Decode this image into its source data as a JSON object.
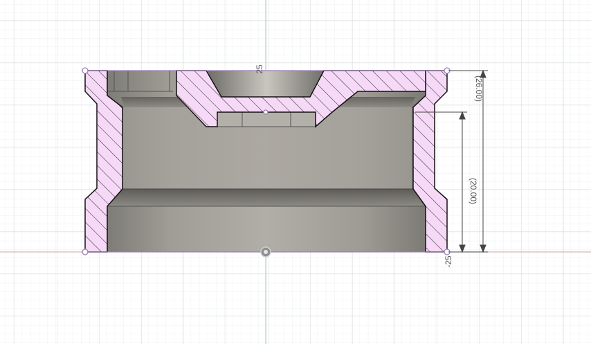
{
  "viewport": {
    "background_color": "#ffffff",
    "grid_minor_color": "#eef0f2",
    "grid_major_color": "#d7dadd",
    "axis_horizontal_color": "#cfa3a3",
    "axis_vertical_color": "#9ccf9c"
  },
  "section": {
    "hatch_fill_color": "#f6d9f7",
    "hatch_line_color": "#222222",
    "cavity_color": "#8c8a84",
    "sketch_point_color": "#9b7fb6"
  },
  "dimensions": {
    "overall_height": "(26.00)",
    "inner_height": "(20.00)",
    "top_marker": "25",
    "bottom_marker": "-25"
  },
  "origin_icon": "origin-point-icon"
}
